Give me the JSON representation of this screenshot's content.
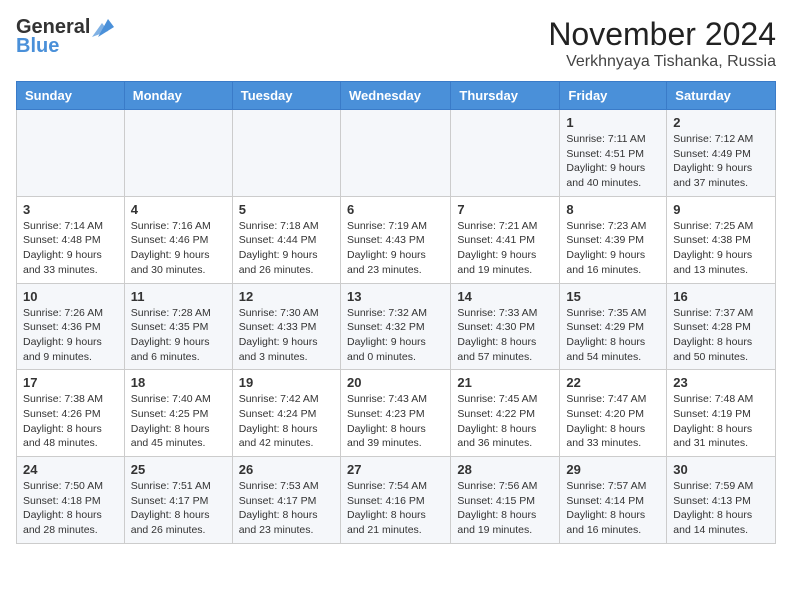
{
  "header": {
    "logo_general": "General",
    "logo_blue": "Blue",
    "month": "November 2024",
    "location": "Verkhnyaya Tishanka, Russia"
  },
  "days_of_week": [
    "Sunday",
    "Monday",
    "Tuesday",
    "Wednesday",
    "Thursday",
    "Friday",
    "Saturday"
  ],
  "weeks": [
    [
      {
        "day": "",
        "info": ""
      },
      {
        "day": "",
        "info": ""
      },
      {
        "day": "",
        "info": ""
      },
      {
        "day": "",
        "info": ""
      },
      {
        "day": "",
        "info": ""
      },
      {
        "day": "1",
        "info": "Sunrise: 7:11 AM\nSunset: 4:51 PM\nDaylight: 9 hours and 40 minutes."
      },
      {
        "day": "2",
        "info": "Sunrise: 7:12 AM\nSunset: 4:49 PM\nDaylight: 9 hours and 37 minutes."
      }
    ],
    [
      {
        "day": "3",
        "info": "Sunrise: 7:14 AM\nSunset: 4:48 PM\nDaylight: 9 hours and 33 minutes."
      },
      {
        "day": "4",
        "info": "Sunrise: 7:16 AM\nSunset: 4:46 PM\nDaylight: 9 hours and 30 minutes."
      },
      {
        "day": "5",
        "info": "Sunrise: 7:18 AM\nSunset: 4:44 PM\nDaylight: 9 hours and 26 minutes."
      },
      {
        "day": "6",
        "info": "Sunrise: 7:19 AM\nSunset: 4:43 PM\nDaylight: 9 hours and 23 minutes."
      },
      {
        "day": "7",
        "info": "Sunrise: 7:21 AM\nSunset: 4:41 PM\nDaylight: 9 hours and 19 minutes."
      },
      {
        "day": "8",
        "info": "Sunrise: 7:23 AM\nSunset: 4:39 PM\nDaylight: 9 hours and 16 minutes."
      },
      {
        "day": "9",
        "info": "Sunrise: 7:25 AM\nSunset: 4:38 PM\nDaylight: 9 hours and 13 minutes."
      }
    ],
    [
      {
        "day": "10",
        "info": "Sunrise: 7:26 AM\nSunset: 4:36 PM\nDaylight: 9 hours and 9 minutes."
      },
      {
        "day": "11",
        "info": "Sunrise: 7:28 AM\nSunset: 4:35 PM\nDaylight: 9 hours and 6 minutes."
      },
      {
        "day": "12",
        "info": "Sunrise: 7:30 AM\nSunset: 4:33 PM\nDaylight: 9 hours and 3 minutes."
      },
      {
        "day": "13",
        "info": "Sunrise: 7:32 AM\nSunset: 4:32 PM\nDaylight: 9 hours and 0 minutes."
      },
      {
        "day": "14",
        "info": "Sunrise: 7:33 AM\nSunset: 4:30 PM\nDaylight: 8 hours and 57 minutes."
      },
      {
        "day": "15",
        "info": "Sunrise: 7:35 AM\nSunset: 4:29 PM\nDaylight: 8 hours and 54 minutes."
      },
      {
        "day": "16",
        "info": "Sunrise: 7:37 AM\nSunset: 4:28 PM\nDaylight: 8 hours and 50 minutes."
      }
    ],
    [
      {
        "day": "17",
        "info": "Sunrise: 7:38 AM\nSunset: 4:26 PM\nDaylight: 8 hours and 48 minutes."
      },
      {
        "day": "18",
        "info": "Sunrise: 7:40 AM\nSunset: 4:25 PM\nDaylight: 8 hours and 45 minutes."
      },
      {
        "day": "19",
        "info": "Sunrise: 7:42 AM\nSunset: 4:24 PM\nDaylight: 8 hours and 42 minutes."
      },
      {
        "day": "20",
        "info": "Sunrise: 7:43 AM\nSunset: 4:23 PM\nDaylight: 8 hours and 39 minutes."
      },
      {
        "day": "21",
        "info": "Sunrise: 7:45 AM\nSunset: 4:22 PM\nDaylight: 8 hours and 36 minutes."
      },
      {
        "day": "22",
        "info": "Sunrise: 7:47 AM\nSunset: 4:20 PM\nDaylight: 8 hours and 33 minutes."
      },
      {
        "day": "23",
        "info": "Sunrise: 7:48 AM\nSunset: 4:19 PM\nDaylight: 8 hours and 31 minutes."
      }
    ],
    [
      {
        "day": "24",
        "info": "Sunrise: 7:50 AM\nSunset: 4:18 PM\nDaylight: 8 hours and 28 minutes."
      },
      {
        "day": "25",
        "info": "Sunrise: 7:51 AM\nSunset: 4:17 PM\nDaylight: 8 hours and 26 minutes."
      },
      {
        "day": "26",
        "info": "Sunrise: 7:53 AM\nSunset: 4:17 PM\nDaylight: 8 hours and 23 minutes."
      },
      {
        "day": "27",
        "info": "Sunrise: 7:54 AM\nSunset: 4:16 PM\nDaylight: 8 hours and 21 minutes."
      },
      {
        "day": "28",
        "info": "Sunrise: 7:56 AM\nSunset: 4:15 PM\nDaylight: 8 hours and 19 minutes."
      },
      {
        "day": "29",
        "info": "Sunrise: 7:57 AM\nSunset: 4:14 PM\nDaylight: 8 hours and 16 minutes."
      },
      {
        "day": "30",
        "info": "Sunrise: 7:59 AM\nSunset: 4:13 PM\nDaylight: 8 hours and 14 minutes."
      }
    ]
  ]
}
